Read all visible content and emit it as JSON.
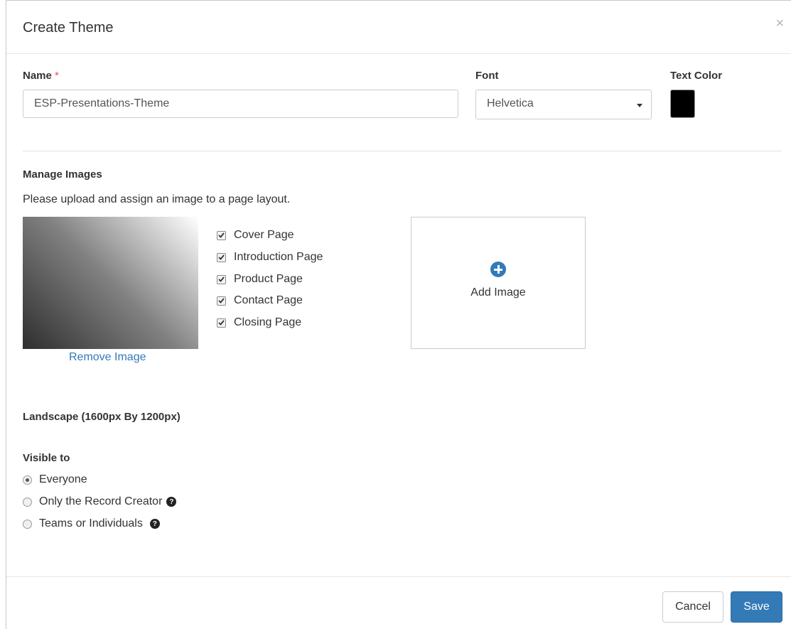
{
  "header": {
    "title": "Create Theme",
    "close_symbol": "×"
  },
  "form": {
    "name_label": "Name",
    "required_mark": "*",
    "name_value": "ESP-Presentations-Theme",
    "font_label": "Font",
    "font_value": "Helvetica",
    "text_color_label": "Text Color",
    "text_color": "#000000"
  },
  "images": {
    "section_title": "Manage Images",
    "description": "Please upload and assign an image to a page layout.",
    "remove_label": "Remove Image",
    "layouts": [
      {
        "label": "Cover Page",
        "checked": true
      },
      {
        "label": "Introduction Page",
        "checked": true
      },
      {
        "label": "Product Page",
        "checked": true
      },
      {
        "label": "Contact Page",
        "checked": true
      },
      {
        "label": "Closing Page",
        "checked": true
      }
    ],
    "add_label": "Add Image",
    "add_icon": "plus-circle-icon"
  },
  "landscape_label": "Landscape (1600px By 1200px)",
  "visibility": {
    "title": "Visible to",
    "options": [
      {
        "label": "Everyone",
        "selected": true,
        "help": false
      },
      {
        "label": "Only the Record Creator",
        "selected": false,
        "help": true
      },
      {
        "label": "Teams or Individuals",
        "selected": false,
        "help": true
      }
    ],
    "help_symbol": "?"
  },
  "footer": {
    "cancel_label": "Cancel",
    "save_label": "Save"
  },
  "colors": {
    "accent": "#337ab7",
    "required": "#d9534f"
  }
}
